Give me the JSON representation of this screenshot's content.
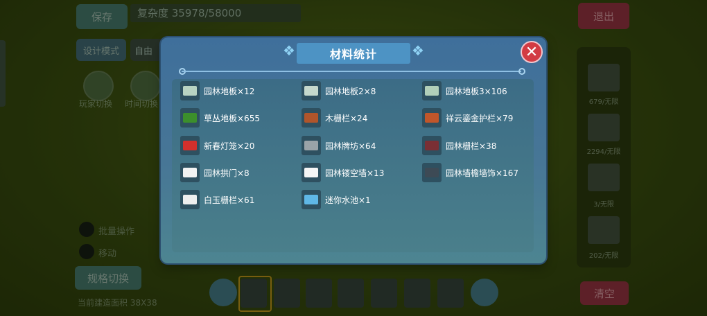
{
  "background": {
    "save_label": "保存",
    "complexity_text": "复杂度 35978/58000",
    "exit_label": "退出",
    "mode_label": "设计模式",
    "free_label": "自由",
    "thumb_labels": [
      "玩家切换",
      "时间切换"
    ],
    "batch_label": "批量操作",
    "move_label": "移动",
    "toggle_label": "规格切换",
    "area_text": "当前建造面积 38X38",
    "clear_label": "清空",
    "right_counts": [
      "679/无限",
      "2294/无限",
      "3/无限",
      "202/无限"
    ]
  },
  "dialog": {
    "title": "材料统计",
    "close_symbol": "✕",
    "items": [
      {
        "label": "园林地板×12",
        "icon": "floor-tile-icon",
        "color": "#b9d3c2"
      },
      {
        "label": "园林地板2×8",
        "icon": "floor-tile-icon",
        "color": "#c5d8cc"
      },
      {
        "label": "园林地板3×106",
        "icon": "floor-tile-icon",
        "color": "#b2cfb9"
      },
      {
        "label": "草丛地板×655",
        "icon": "grass-floor-icon",
        "color": "#3c8f2c"
      },
      {
        "label": "木栅栏×24",
        "icon": "wood-fence-icon",
        "color": "#b0552b"
      },
      {
        "label": "祥云鎏金护栏×79",
        "icon": "gold-railing-icon",
        "color": "#c0562a"
      },
      {
        "label": "新春灯笼×20",
        "icon": "lantern-icon",
        "color": "#d2302c"
      },
      {
        "label": "园林牌坊×64",
        "icon": "archway-icon",
        "color": "#9aa3a8"
      },
      {
        "label": "园林栅栏×38",
        "icon": "garden-fence-icon",
        "color": "#7a2f34"
      },
      {
        "label": "园林拱门×8",
        "icon": "arch-door-icon",
        "color": "#f2f2f2"
      },
      {
        "label": "园林镂空墙×13",
        "icon": "hollow-wall-icon",
        "color": "#f5f5f5"
      },
      {
        "label": "园林墙檐墙饰×167",
        "icon": "wall-eave-icon",
        "color": "#3d4a55"
      },
      {
        "label": "白玉栅栏×61",
        "icon": "jade-fence-icon",
        "color": "#eeeeee"
      },
      {
        "label": "迷你水池×1",
        "icon": "mini-pool-icon",
        "color": "#5fb7e6"
      }
    ]
  }
}
